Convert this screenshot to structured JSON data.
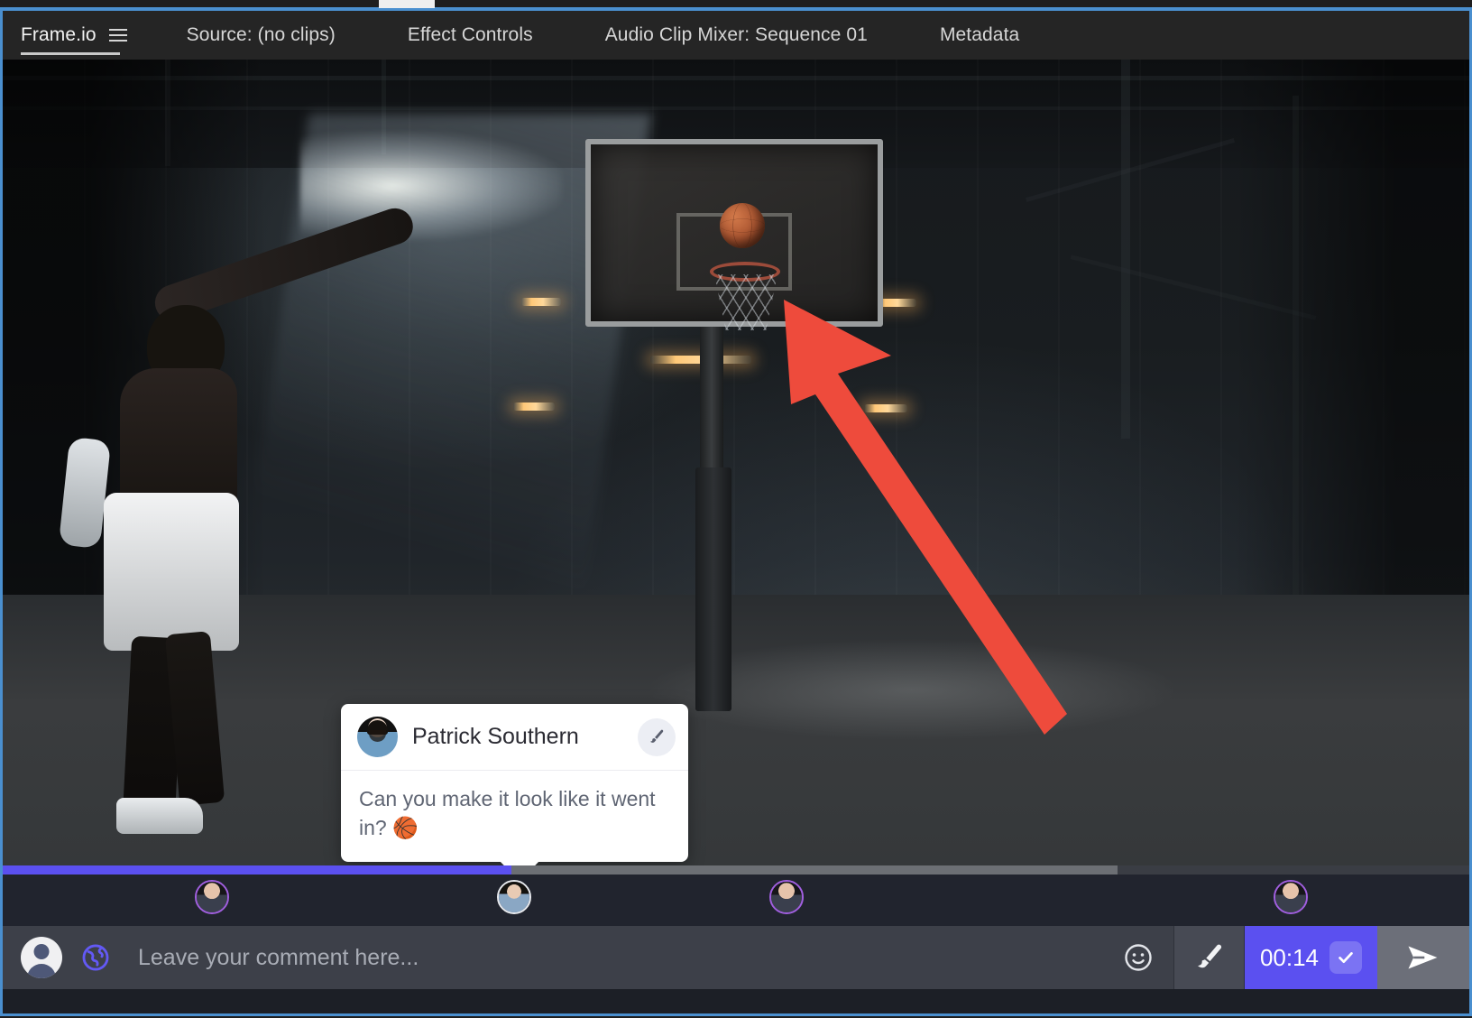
{
  "window": {
    "panel_border_color": "#4a8fcf"
  },
  "tabbar": {
    "tabs": [
      {
        "label": "Frame.io",
        "active": true,
        "has_menu_icon": true,
        "menu_icon": "hamburger-icon"
      },
      {
        "label": "Source: (no clips)",
        "active": false
      },
      {
        "label": "Effect Controls",
        "active": false
      },
      {
        "label": "Audio Clip Mixer: Sequence 01",
        "active": false
      },
      {
        "label": "Metadata",
        "active": false
      }
    ]
  },
  "viewer": {
    "scene_description": "Basketball shot at a dark warehouse hoop",
    "annotation": {
      "type": "arrow",
      "color": "#ee4b3c",
      "points_to": "basketball-hoop"
    }
  },
  "comment_popup": {
    "author": "Patrick Southern",
    "avatar": "user-avatar",
    "draw_icon": "brush-icon",
    "text": "Can you make it look like it went in? 🏀"
  },
  "scrubber": {
    "played_color": "#5b50f0",
    "progress_percent": 34.7,
    "buffered_percent": 76
  },
  "comment_markers": [
    {
      "position_percent": 14.3,
      "current": false,
      "avatar": "commenter-avatar"
    },
    {
      "position_percent": 34.8,
      "current": true,
      "avatar": "commenter-avatar-active"
    },
    {
      "position_percent": 53.3,
      "current": false,
      "avatar": "commenter-avatar"
    },
    {
      "position_percent": 87.6,
      "current": false,
      "avatar": "commenter-avatar"
    }
  ],
  "composer": {
    "avatar": "current-user-avatar",
    "globe_icon": "globe-icon",
    "placeholder": "Leave your comment here...",
    "value": "",
    "emoji_icon": "emoji-smiley-icon",
    "brush_icon": "brush-icon",
    "timecode": "00:14",
    "timecode_check_icon": "check-icon",
    "timecode_color": "#5b50f0",
    "send_icon": "send-icon"
  }
}
